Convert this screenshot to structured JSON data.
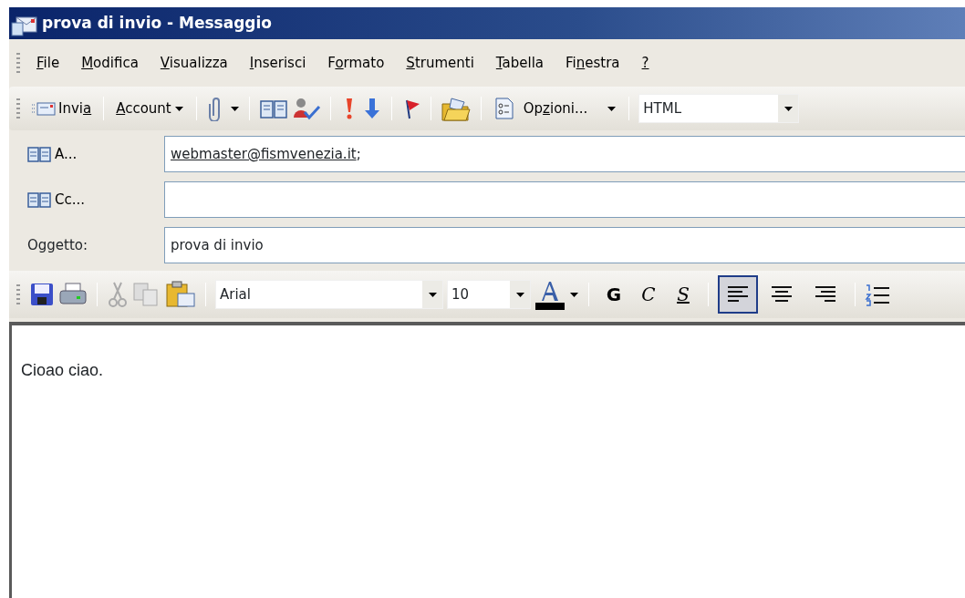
{
  "window": {
    "title": "prova di invio - Messaggio"
  },
  "menu": [
    {
      "key": "F",
      "post": "ile"
    },
    {
      "key": "M",
      "post": "odifica"
    },
    {
      "key": "V",
      "post": "isualizza"
    },
    {
      "key": "I",
      "post": "nserisci"
    },
    {
      "pre": "F",
      "key": "o",
      "post": "rmato"
    },
    {
      "key": "S",
      "post": "trumenti"
    },
    {
      "key": "T",
      "post": "abella"
    },
    {
      "pre": "Fi",
      "key": "n",
      "post": "estra"
    },
    {
      "key": "?"
    }
  ],
  "toolbar": {
    "send": {
      "pre": "Invi",
      "key": "a"
    },
    "account": {
      "key": "A",
      "post": "ccount"
    },
    "options": {
      "pre": "Op",
      "key": "z",
      "post": "ioni..."
    },
    "message_format": "HTML"
  },
  "headers": [
    {
      "kind": "address",
      "label": "A...",
      "value": "webmaster@fismvenezia.it",
      "suffix": ";"
    },
    {
      "kind": "address",
      "label": "Cc..."
    },
    {
      "kind": "text",
      "label": "Oggetto:",
      "value": "prova di invio"
    }
  ],
  "formatting": {
    "font": "Arial",
    "size": "10",
    "bold": "G",
    "italic": "C",
    "underline": "S",
    "alignment": [
      {
        "selected": true
      },
      {
        "selected": false
      },
      {
        "selected": false
      }
    ]
  },
  "body": "Cioao ciao."
}
